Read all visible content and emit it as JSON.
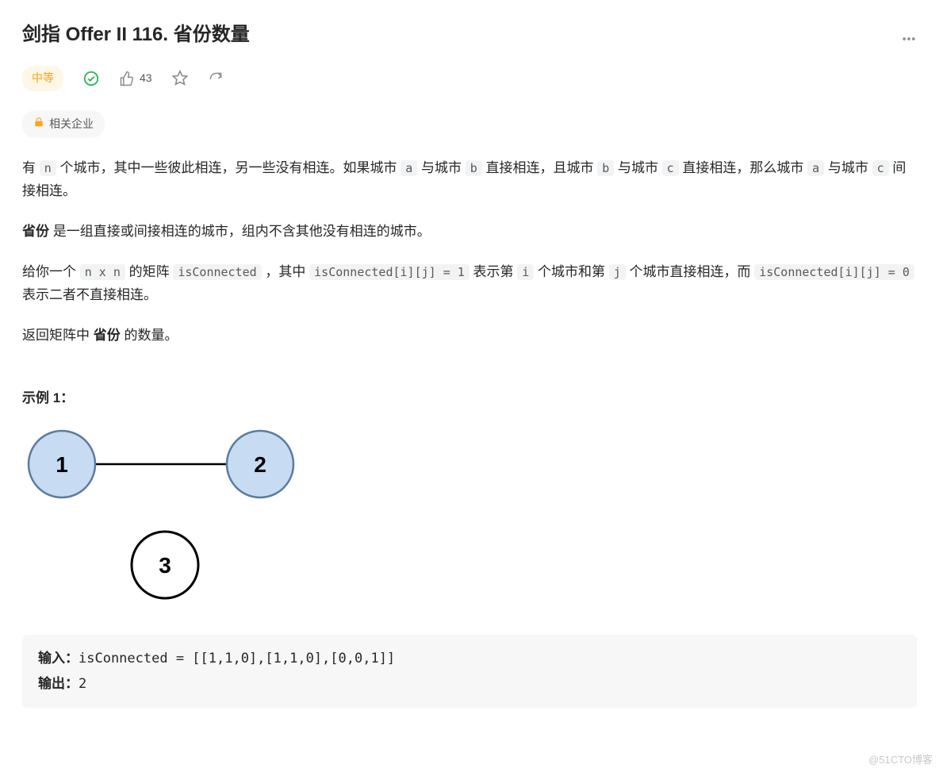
{
  "title": "剑指 Offer II 116. 省份数量",
  "difficulty": "中等",
  "like_count": "43",
  "company_tag": "相关企业",
  "desc": {
    "p1_a": "有 ",
    "p1_b": " 个城市，其中一些彼此相连，另一些没有相连。如果城市 ",
    "p1_c": " 与城市 ",
    "p1_d": " 直接相连，且城市 ",
    "p1_e": " 与城市 ",
    "p1_f": " 直接相连，那么城市 ",
    "p1_g": " 与城市 ",
    "p1_h": " 间接相连。",
    "c_n": "n",
    "c_a": "a",
    "c_b": "b",
    "c_c": "c",
    "p2_a": "省份",
    "p2_b": " 是一组直接或间接相连的城市，组内不含其他没有相连的城市。",
    "p3_a": "给你一个 ",
    "p3_b": " 的矩阵 ",
    "p3_c": " ，其中 ",
    "p3_d": " 表示第 ",
    "p3_e": " 个城市和第 ",
    "p3_f": " 个城市直接相连，而 ",
    "p3_g": " 表示二者不直接相连。",
    "c_nxn": "n x n",
    "c_isc": "isConnected",
    "c_eq1": "isConnected[i][j] = 1",
    "c_i": "i",
    "c_j": "j",
    "c_eq0": "isConnected[i][j] = 0",
    "p4_a": "返回矩阵中 ",
    "p4_b": "省份",
    "p4_c": " 的数量。"
  },
  "example_heading": "示例 1：",
  "graph": {
    "n1": "1",
    "n2": "2",
    "n3": "3"
  },
  "example": {
    "input_label": "输入：",
    "input_value": "isConnected = [[1,1,0],[1,1,0],[0,0,1]]",
    "output_label": "输出：",
    "output_value": "2"
  },
  "watermark": "@51CTO博客"
}
